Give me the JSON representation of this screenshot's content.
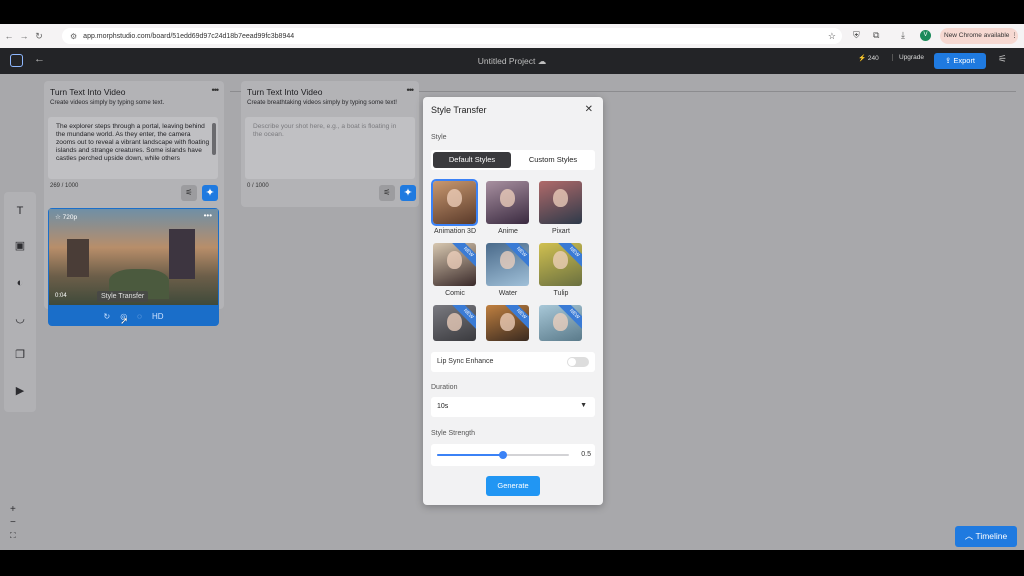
{
  "browser": {
    "url": "app.morphstudio.com/board/51edd69d97c24d18b7eead99fc3b8944",
    "avatar_letter": "V",
    "update_label": "New Chrome available"
  },
  "header": {
    "project_title": "Untitled Project",
    "credits": "240",
    "upgrade_label": "Upgrade",
    "export_label": "Export"
  },
  "panel1": {
    "title": "Turn Text Into Video",
    "subtitle": "Create videos simply by typing some text.",
    "prompt_text": "The explorer steps through a portal, leaving behind the mundane world. As they enter, the camera zooms out to reveal a vibrant landscape with floating islands and strange creatures. Some islands have castles perched upside down, while others",
    "counter": "269 / 1000"
  },
  "panel2": {
    "title": "Turn Text Into Video",
    "subtitle": "Create breathtaking videos simply by typing some text!",
    "placeholder": "Describe your shot here, e.g., a boat is floating in the ocean.",
    "counter": "0 / 1000"
  },
  "video_card": {
    "badge": "720p",
    "timestamp": "0:04",
    "tooltip": "Style Transfer",
    "hd_label": "HD"
  },
  "modal": {
    "title": "Style Transfer",
    "style_label": "Style",
    "tab_default": "Default Styles",
    "tab_custom": "Custom Styles",
    "styles": [
      {
        "label": "Animation 3D",
        "selected": true,
        "new": false
      },
      {
        "label": "Anime",
        "selected": false,
        "new": false
      },
      {
        "label": "Pixart",
        "selected": false,
        "new": false
      },
      {
        "label": "Comic",
        "selected": false,
        "new": true
      },
      {
        "label": "Water",
        "selected": false,
        "new": true
      },
      {
        "label": "Tulip",
        "selected": false,
        "new": true
      },
      {
        "label": "",
        "selected": false,
        "new": true
      },
      {
        "label": "",
        "selected": false,
        "new": true
      },
      {
        "label": "",
        "selected": false,
        "new": true
      }
    ],
    "new_badge": "NEW",
    "lip_sync_label": "Lip Sync Enhance",
    "lip_sync_enabled": false,
    "duration_label": "Duration",
    "duration_value": "10s",
    "strength_label": "Style Strength",
    "strength_value": "0.5",
    "strength_fraction": 0.5,
    "generate_label": "Generate"
  },
  "timeline_label": "Timeline",
  "colors": {
    "accent": "#1f7ae0",
    "canvas": "#a8a8ab",
    "header": "#232427"
  }
}
